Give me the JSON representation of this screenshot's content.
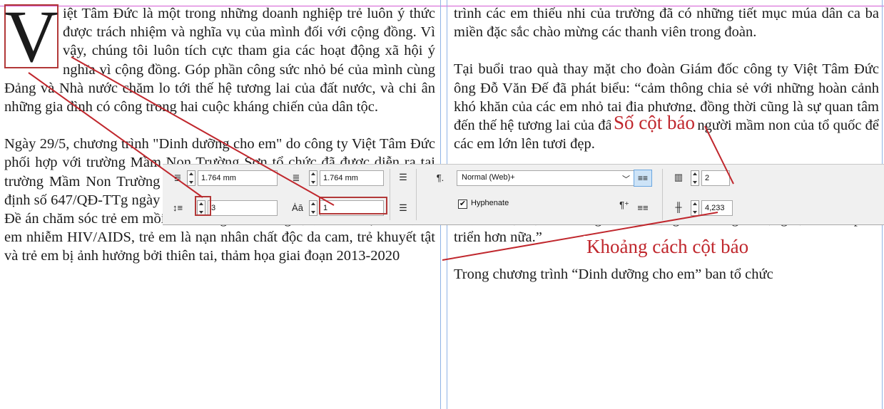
{
  "document": {
    "dropcap_letter": "V",
    "left_column": {
      "p1": "iệt Tâm Đức là một trong những doanh nghiệp trẻ luôn ý thức được trách nhiệm và nghĩa vụ của mình đối với cộng đồng. Vì vậy, chúng tôi luôn tích cực tham gia các hoạt động xã hội ý nghĩa vì cộng đồng. Góp phần công sức nhỏ bé của mình cùng Đảng và Nhà nước chăm lo tới thế hệ tương lai của đất nước, và chi ân những gia đình có công trong hai cuộc kháng chiến của dân tộc.",
      "p2": "Ngày 29/5, chương trình \"Dinh dưỡng cho em\" do công ty Việt Tâm Đức phối hợp với trường Mầm Non Trường Sơn tổ chức đã được diễn ra tại trường Mầm Non Trường Sơn. Đây là chương trình hưởng ứng Quyết định số 647/QĐ-TTg ngày 26/4/2013 của Thủ tướng chính phủ phê duyệt Đề án chăm sóc trẻ em mồi côi không nơi nương tựa, trẻ em bị bỏ rơi, trẻ em nhiễm HIV/AIDS, trẻ em là nạn nhân chất độc da cam, trẻ khuyết tật và trẻ em bị ảnh hưởng bởi thiên tai, thảm họa giai đoạn 2013-2020"
    },
    "right_column": {
      "p1": "trình các em thiếu nhi của trường đã có những tiết mục múa dân ca ba miền đặc sắc chào mừng các thanh viên trong đoàn.",
      "p2": "Tại buổi trao quà thay mặt cho đoàn Giám đốc công ty Việt Tâm Đức ông Đỗ Văn Đế đã phát biểu: “cảm thông chia sẻ với những hoàn cảnh khó khăn của các em nhỏ tại địa phương, đồng thời cũng là sự quan tâm đến thế hệ tương lai của đất nước, những người mầm non của tổ quốc để các em lớn lên tươi đẹp.",
      "p3": "Rất vinh dự cho tôi là người con sinh ra và lớn lên từ quê hương nay lại được trở về góp một phần nhỏ bé của mình vào việc chăm lo cho các em, tôi thật sự vui mừng và xúc động. Đó cũng là động lực để tôi phát triển hơn nữa.”",
      "p4": "Trong chương trình “Dinh dưỡng cho em” ban tổ chức"
    }
  },
  "toolbar": {
    "space_before": "1.764 mm",
    "space_after": "1.764 mm",
    "dropcap_lines": "3",
    "dropcap_chars": "1",
    "paragraph_style": "Normal (Web)+",
    "hyphenate_label": "Hyphenate",
    "hyphenate_checked": "✔",
    "columns_count": "2",
    "gutter": "4,233"
  },
  "annotations": {
    "columns_label": "Số cột báo",
    "gutter_label": "Khoảng cách cột báo"
  },
  "colors": {
    "annotation": "#c0272d",
    "highlight_box": "#b23838",
    "guide_magenta": "#d35bd3",
    "guide_blue": "#8fb3e6",
    "toolbar_bg": "#f0f0f0"
  },
  "icons": [
    "space-before-icon",
    "space-after-icon",
    "dropcap-lines-icon",
    "dropcap-chars-icon",
    "paragraph-mark-icon",
    "align-justify-icon",
    "columns-icon",
    "gutter-icon",
    "chevron-down-icon"
  ]
}
